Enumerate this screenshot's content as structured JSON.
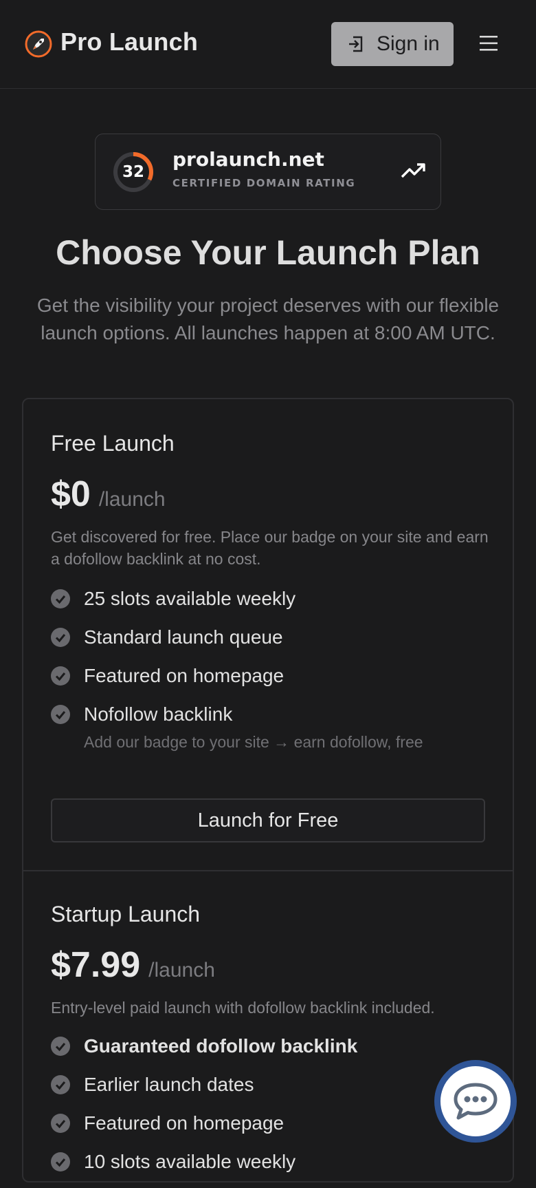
{
  "header": {
    "brand": "Pro Launch",
    "signin_label": "Sign in",
    "logo_icon": "rocket-logo-icon",
    "menu_icon": "hamburger-menu-icon"
  },
  "badge": {
    "score": "32",
    "domain": "prolaunch.net",
    "rating_label": "CERTIFIED DOMAIN RATING",
    "score_fraction": 0.32,
    "accent_color": "#f26b2a"
  },
  "hero": {
    "title": "Choose Your Launch Plan",
    "subtitle": "Get the visibility your project deserves with our flexible launch options. All launches happen at 8:00 AM UTC."
  },
  "plans": [
    {
      "name": "Free Launch",
      "price": "$0",
      "per": "/launch",
      "description": "Get discovered for free. Place our badge on your site and earn a dofollow backlink at no cost.",
      "features": [
        {
          "label": "25 slots available weekly"
        },
        {
          "label": "Standard launch queue"
        },
        {
          "label": "Featured on homepage"
        },
        {
          "label": "Nofollow backlink",
          "note": "Add our badge to your site → earn dofollow, free"
        }
      ],
      "cta": "Launch for Free"
    },
    {
      "name": "Startup Launch",
      "price": "$7.99",
      "per": "/launch",
      "description": "Entry-level paid launch with dofollow backlink included.",
      "features": [
        {
          "label": "Guaranteed dofollow backlink"
        },
        {
          "label": "Earlier launch dates"
        },
        {
          "label": "Featured on homepage"
        },
        {
          "label": "10 slots available weekly"
        }
      ]
    }
  ],
  "chat": {
    "icon": "chat-bubble-icon"
  }
}
